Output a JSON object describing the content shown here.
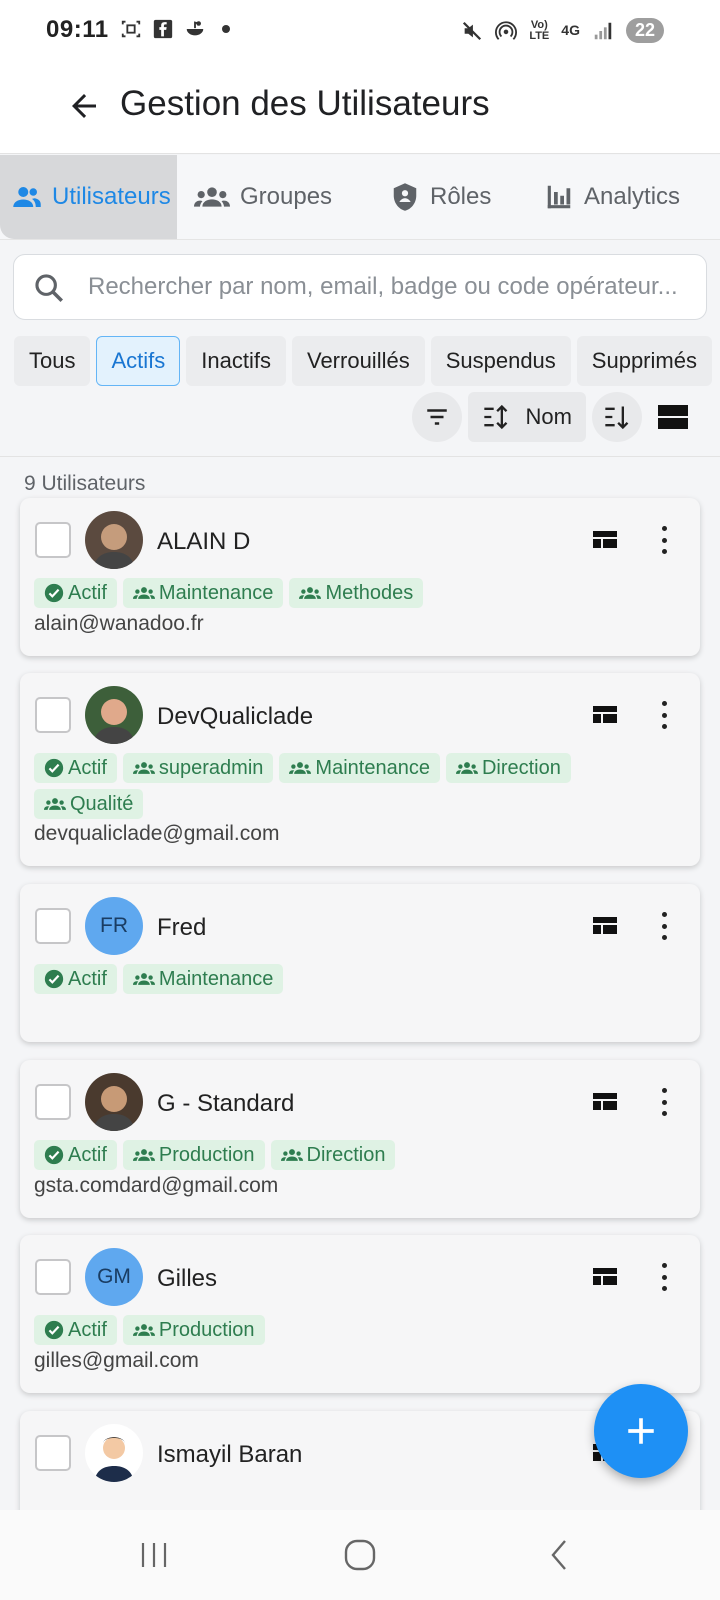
{
  "status": {
    "time": "09:11",
    "volte": "Vo)\nLTE",
    "network": "4G",
    "battery": "22",
    "icons": [
      "screenshot-icon",
      "facebook-icon",
      "app-icon",
      "mute-icon",
      "hotspot-icon",
      "signal-icon"
    ]
  },
  "appbar": {
    "title": "Gestion des Utilisateurs"
  },
  "tabs": [
    {
      "label": "Utilisateurs",
      "icon": "users-icon",
      "active": true
    },
    {
      "label": "Groupes",
      "icon": "groups-icon",
      "active": false
    },
    {
      "label": "Rôles",
      "icon": "shield-icon",
      "active": false
    },
    {
      "label": "Analytics",
      "icon": "bar-chart-icon",
      "active": false
    }
  ],
  "search": {
    "placeholder": "Rechercher par nom, email, badge ou code opérateur..."
  },
  "filters": [
    {
      "label": "Tous",
      "active": false
    },
    {
      "label": "Actifs",
      "active": true
    },
    {
      "label": "Inactifs",
      "active": false
    },
    {
      "label": "Verrouillés",
      "active": false
    },
    {
      "label": "Suspendus",
      "active": false
    },
    {
      "label": "Supprimés",
      "active": false
    }
  ],
  "toolbar": {
    "sort_label": "Nom"
  },
  "list": {
    "count_label": "9 Utilisateurs"
  },
  "users": [
    {
      "name": "ALAIN D",
      "avatar": "photo",
      "tags": [
        "Actif",
        "Maintenance",
        "Methodes"
      ],
      "email": "alain@wanadoo.fr"
    },
    {
      "name": "DevQualiclade",
      "avatar": "photo",
      "tags": [
        "Actif",
        "superadmin",
        "Maintenance",
        "Direction",
        "Qualité"
      ],
      "email": "devqualiclade@gmail.com"
    },
    {
      "name": "Fred",
      "avatar": "FR",
      "tags": [
        "Actif",
        "Maintenance"
      ],
      "email": ""
    },
    {
      "name": "G - Standard",
      "avatar": "photo",
      "tags": [
        "Actif",
        "Production",
        "Direction"
      ],
      "email": "gsta.comdard@gmail.com"
    },
    {
      "name": "Gilles",
      "avatar": "GM",
      "tags": [
        "Actif",
        "Production"
      ],
      "email": "gilles@gmail.com"
    },
    {
      "name": "Ismayil Baran",
      "avatar": "photo",
      "tags": [],
      "email": ""
    }
  ],
  "colors": {
    "accent": "#1e88e5",
    "tag_bg": "#dff2e4",
    "tag_fg": "#2e7d4f",
    "fab": "#1e90f5"
  }
}
